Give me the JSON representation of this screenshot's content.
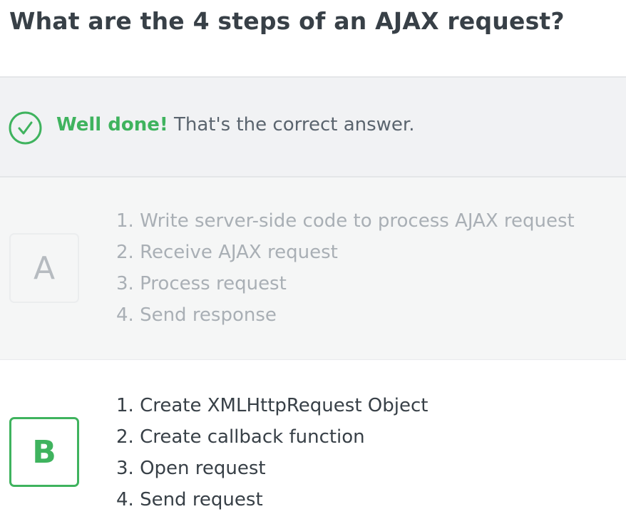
{
  "question": "What are the 4 steps of an AJAX request?",
  "feedback": {
    "icon": "check-circle-icon",
    "status_color": "#3fb35e",
    "strong": "Well done!",
    "message": " That's the correct answer."
  },
  "options": [
    {
      "letter": "A",
      "state": "unselected",
      "steps": [
        "1. Write server-side code to process AJAX request",
        "2. Receive AJAX request",
        "3. Process request",
        "4. Send response"
      ]
    },
    {
      "letter": "B",
      "state": "correct",
      "steps": [
        "1. Create XMLHttpRequest Object",
        "2. Create callback function",
        "3. Open request",
        "4. Send request"
      ]
    }
  ]
}
